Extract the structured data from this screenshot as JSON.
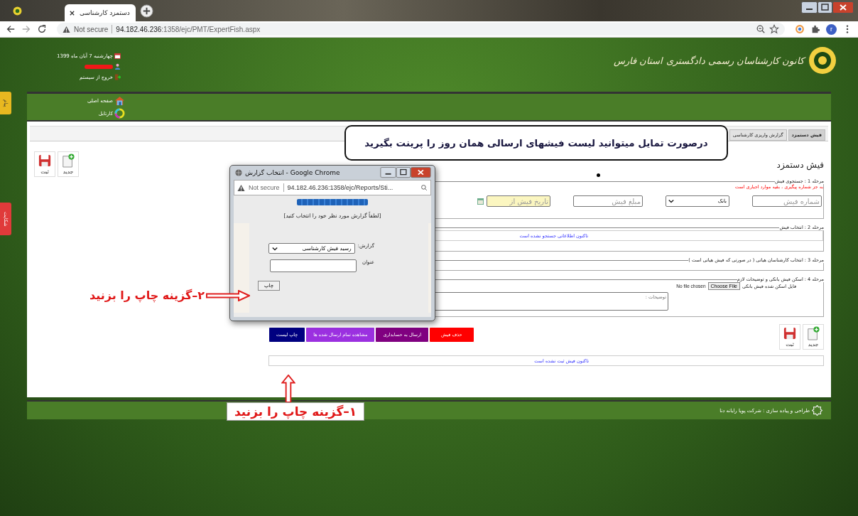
{
  "browser": {
    "tab_title": "دستمزد کارشناسی",
    "security": "Not secure",
    "url_host": "94.182.46.236",
    "url_path": ":1358/ejc/PMT/ExpertFish.aspx",
    "profile": "r"
  },
  "header": {
    "org_name": "کانون کارشناسان رسمی دادگستری استان فارس",
    "date": "چهارشنبه 7 آبان ماه 1399",
    "logout": "خروج از سیستم"
  },
  "side_tabs": [
    {
      "label": "پیام",
      "color": "#e8b820"
    },
    {
      "label": "شکایت",
      "color": "#e03a3a"
    }
  ],
  "nav": [
    {
      "kind": "home",
      "label": "صفحه اصلی"
    },
    {
      "kind": "inbox",
      "label": "کارتابل"
    }
  ],
  "tabs": [
    {
      "label": "فیش دستمزد",
      "selected": true
    },
    {
      "label": "گزارش واریزی کارشناسی",
      "selected": false
    }
  ],
  "callout": "درصورت تمایل میتوانید لیست فیشهای ارسالی همان روز را پرینت بگیرید",
  "page_title": "فیش دستمزد",
  "toolbar": [
    {
      "kind": "new",
      "label": "جدید"
    },
    {
      "kind": "save",
      "label": "ثبت"
    }
  ],
  "steps": [
    {
      "kind": "search",
      "legend": "مرحله 1 : جستجوی فیش",
      "note": "به جز شماره پیگیری ، بقیه موارد اجباری است",
      "receipt_number": {
        "placeholder": "شماره فیش"
      },
      "bank": {
        "value": "بانک"
      },
      "amount": {
        "placeholder": "مبلغ فیش"
      },
      "date_from": {
        "placeholder": "تاریخ فیش از"
      }
    },
    {
      "kind": "message",
      "legend": "مرحله 2 : انتخاب فیش",
      "message": "تاکنون اطلاعاتی جستجو نشده است"
    },
    {
      "kind": "empty",
      "legend": "مرحله 3 : انتخاب کارشناسان هیاتی ( در صورتی که فیش هیاتی است )"
    },
    {
      "kind": "upload",
      "legend": "مرحله 4 : اسکن فیش بانکی و توضیحات لازم",
      "file_label": "فایل اسکن شده فیش بانکی",
      "file_button": "Choose File",
      "file_status": "No file chosen",
      "notes": {
        "placeholder": "توضیحات :"
      }
    }
  ],
  "actions": [
    {
      "label": "حذف فیش",
      "color": "#ff0000"
    },
    {
      "label": "ارسال به حسابداری",
      "color": "#800080"
    },
    {
      "label": "مشاهده تمام ارسال شده ها",
      "color": "#9b30e0"
    },
    {
      "label": "چاپ لیست",
      "color": "#000080"
    }
  ],
  "bottom_toolbar": [
    {
      "kind": "new",
      "label": "جدید"
    },
    {
      "kind": "save",
      "label": "ثبت"
    }
  ],
  "status_message": "تاکنون فیش ثبت نشده است",
  "footer": "طراحی و پیاده سازی : شرکت پویا رایانه دنا",
  "popup": {
    "title": "انتخاب گزارش - Google Chrome",
    "security": "Not secure",
    "url": "94.182.46.236:1358/ejc/Reports/Sti...",
    "prompt": "[لطفاً گزارش مورد نظر خود را انتخاب کنید]",
    "report_label": "گزارش:",
    "report_value": "رسید فیش کارشناسی",
    "title_label": "عنوان",
    "print_button": "چاپ"
  },
  "annotations": [
    {
      "kind": "up",
      "text": "۱–گزینه چاپ را بزنید"
    },
    {
      "kind": "right",
      "text": "۲–گزینه چاپ را بزنید"
    }
  ]
}
